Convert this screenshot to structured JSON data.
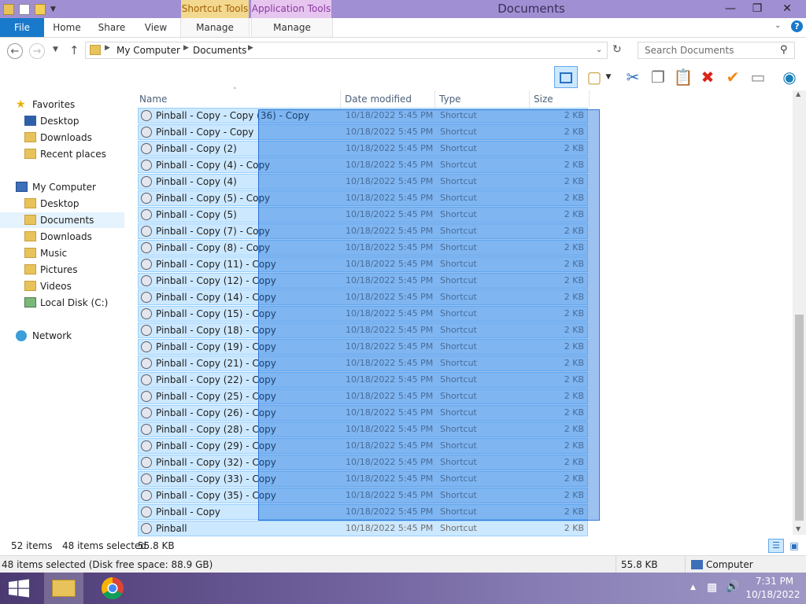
{
  "window": {
    "title": "Documents",
    "context_tabs": {
      "shortcut_tools": "Shortcut Tools",
      "application_tools": "Application Tools"
    },
    "ribbon_tabs": [
      "File",
      "Home",
      "Share",
      "View",
      "Manage",
      "Manage"
    ]
  },
  "address": {
    "breadcrumb": [
      "My Computer",
      "Documents"
    ],
    "search_placeholder": "Search Documents"
  },
  "nav": {
    "favorites": {
      "label": "Favorites",
      "items": [
        "Desktop",
        "Downloads",
        "Recent places"
      ]
    },
    "computer": {
      "label": "My Computer",
      "items": [
        "Desktop",
        "Documents",
        "Downloads",
        "Music",
        "Pictures",
        "Videos",
        "Local Disk (C:)"
      ]
    },
    "network": "Network",
    "selected": "Documents"
  },
  "columns": [
    "Name",
    "Date modified",
    "Type",
    "Size"
  ],
  "rows": [
    {
      "name": "Pinball - Copy - Copy (36) - Copy",
      "date": "10/18/2022 5:45 PM",
      "type": "Shortcut",
      "size": "2 KB"
    },
    {
      "name": "Pinball - Copy - Copy",
      "date": "10/18/2022 5:45 PM",
      "type": "Shortcut",
      "size": "2 KB"
    },
    {
      "name": "Pinball - Copy (2)",
      "date": "10/18/2022 5:45 PM",
      "type": "Shortcut",
      "size": "2 KB"
    },
    {
      "name": "Pinball - Copy (4) - Copy",
      "date": "10/18/2022 5:45 PM",
      "type": "Shortcut",
      "size": "2 KB"
    },
    {
      "name": "Pinball - Copy (4)",
      "date": "10/18/2022 5:45 PM",
      "type": "Shortcut",
      "size": "2 KB"
    },
    {
      "name": "Pinball - Copy (5) - Copy",
      "date": "10/18/2022 5:45 PM",
      "type": "Shortcut",
      "size": "2 KB"
    },
    {
      "name": "Pinball - Copy (5)",
      "date": "10/18/2022 5:45 PM",
      "type": "Shortcut",
      "size": "2 KB"
    },
    {
      "name": "Pinball - Copy (7) - Copy",
      "date": "10/18/2022 5:45 PM",
      "type": "Shortcut",
      "size": "2 KB"
    },
    {
      "name": "Pinball - Copy (8) - Copy",
      "date": "10/18/2022 5:45 PM",
      "type": "Shortcut",
      "size": "2 KB"
    },
    {
      "name": "Pinball - Copy (11) - Copy",
      "date": "10/18/2022 5:45 PM",
      "type": "Shortcut",
      "size": "2 KB"
    },
    {
      "name": "Pinball - Copy (12) - Copy",
      "date": "10/18/2022 5:45 PM",
      "type": "Shortcut",
      "size": "2 KB"
    },
    {
      "name": "Pinball - Copy (14) - Copy",
      "date": "10/18/2022 5:45 PM",
      "type": "Shortcut",
      "size": "2 KB"
    },
    {
      "name": "Pinball - Copy (15) - Copy",
      "date": "10/18/2022 5:45 PM",
      "type": "Shortcut",
      "size": "2 KB"
    },
    {
      "name": "Pinball - Copy (18) - Copy",
      "date": "10/18/2022 5:45 PM",
      "type": "Shortcut",
      "size": "2 KB"
    },
    {
      "name": "Pinball - Copy (19) - Copy",
      "date": "10/18/2022 5:45 PM",
      "type": "Shortcut",
      "size": "2 KB"
    },
    {
      "name": "Pinball - Copy (21) - Copy",
      "date": "10/18/2022 5:45 PM",
      "type": "Shortcut",
      "size": "2 KB"
    },
    {
      "name": "Pinball - Copy (22) - Copy",
      "date": "10/18/2022 5:45 PM",
      "type": "Shortcut",
      "size": "2 KB"
    },
    {
      "name": "Pinball - Copy (25) - Copy",
      "date": "10/18/2022 5:45 PM",
      "type": "Shortcut",
      "size": "2 KB"
    },
    {
      "name": "Pinball - Copy (26) - Copy",
      "date": "10/18/2022 5:45 PM",
      "type": "Shortcut",
      "size": "2 KB"
    },
    {
      "name": "Pinball - Copy (28) - Copy",
      "date": "10/18/2022 5:45 PM",
      "type": "Shortcut",
      "size": "2 KB"
    },
    {
      "name": "Pinball - Copy (29) - Copy",
      "date": "10/18/2022 5:45 PM",
      "type": "Shortcut",
      "size": "2 KB"
    },
    {
      "name": "Pinball - Copy (32) - Copy",
      "date": "10/18/2022 5:45 PM",
      "type": "Shortcut",
      "size": "2 KB"
    },
    {
      "name": "Pinball - Copy (33) - Copy",
      "date": "10/18/2022 5:45 PM",
      "type": "Shortcut",
      "size": "2 KB"
    },
    {
      "name": "Pinball - Copy (35) - Copy",
      "date": "10/18/2022 5:45 PM",
      "type": "Shortcut",
      "size": "2 KB"
    },
    {
      "name": "Pinball - Copy",
      "date": "10/18/2022 5:45 PM",
      "type": "Shortcut",
      "size": "2 KB"
    },
    {
      "name": "Pinball",
      "date": "10/18/2022 5:45 PM",
      "type": "Shortcut",
      "size": "2 KB"
    }
  ],
  "status": {
    "items": "52 items",
    "selected": "48 items selected",
    "size": "55.8 KB",
    "details": "48 items selected (Disk free space: 88.9 GB)",
    "details_size": "55.8 KB",
    "location": "Computer"
  },
  "taskbar": {
    "time": "7:31 PM",
    "date": "10/18/2022"
  },
  "colors": {
    "accent": "#1979ca",
    "titlebar": "#a08fd2",
    "selection": "#cce8ff",
    "taskbar": "#5d4c88"
  }
}
